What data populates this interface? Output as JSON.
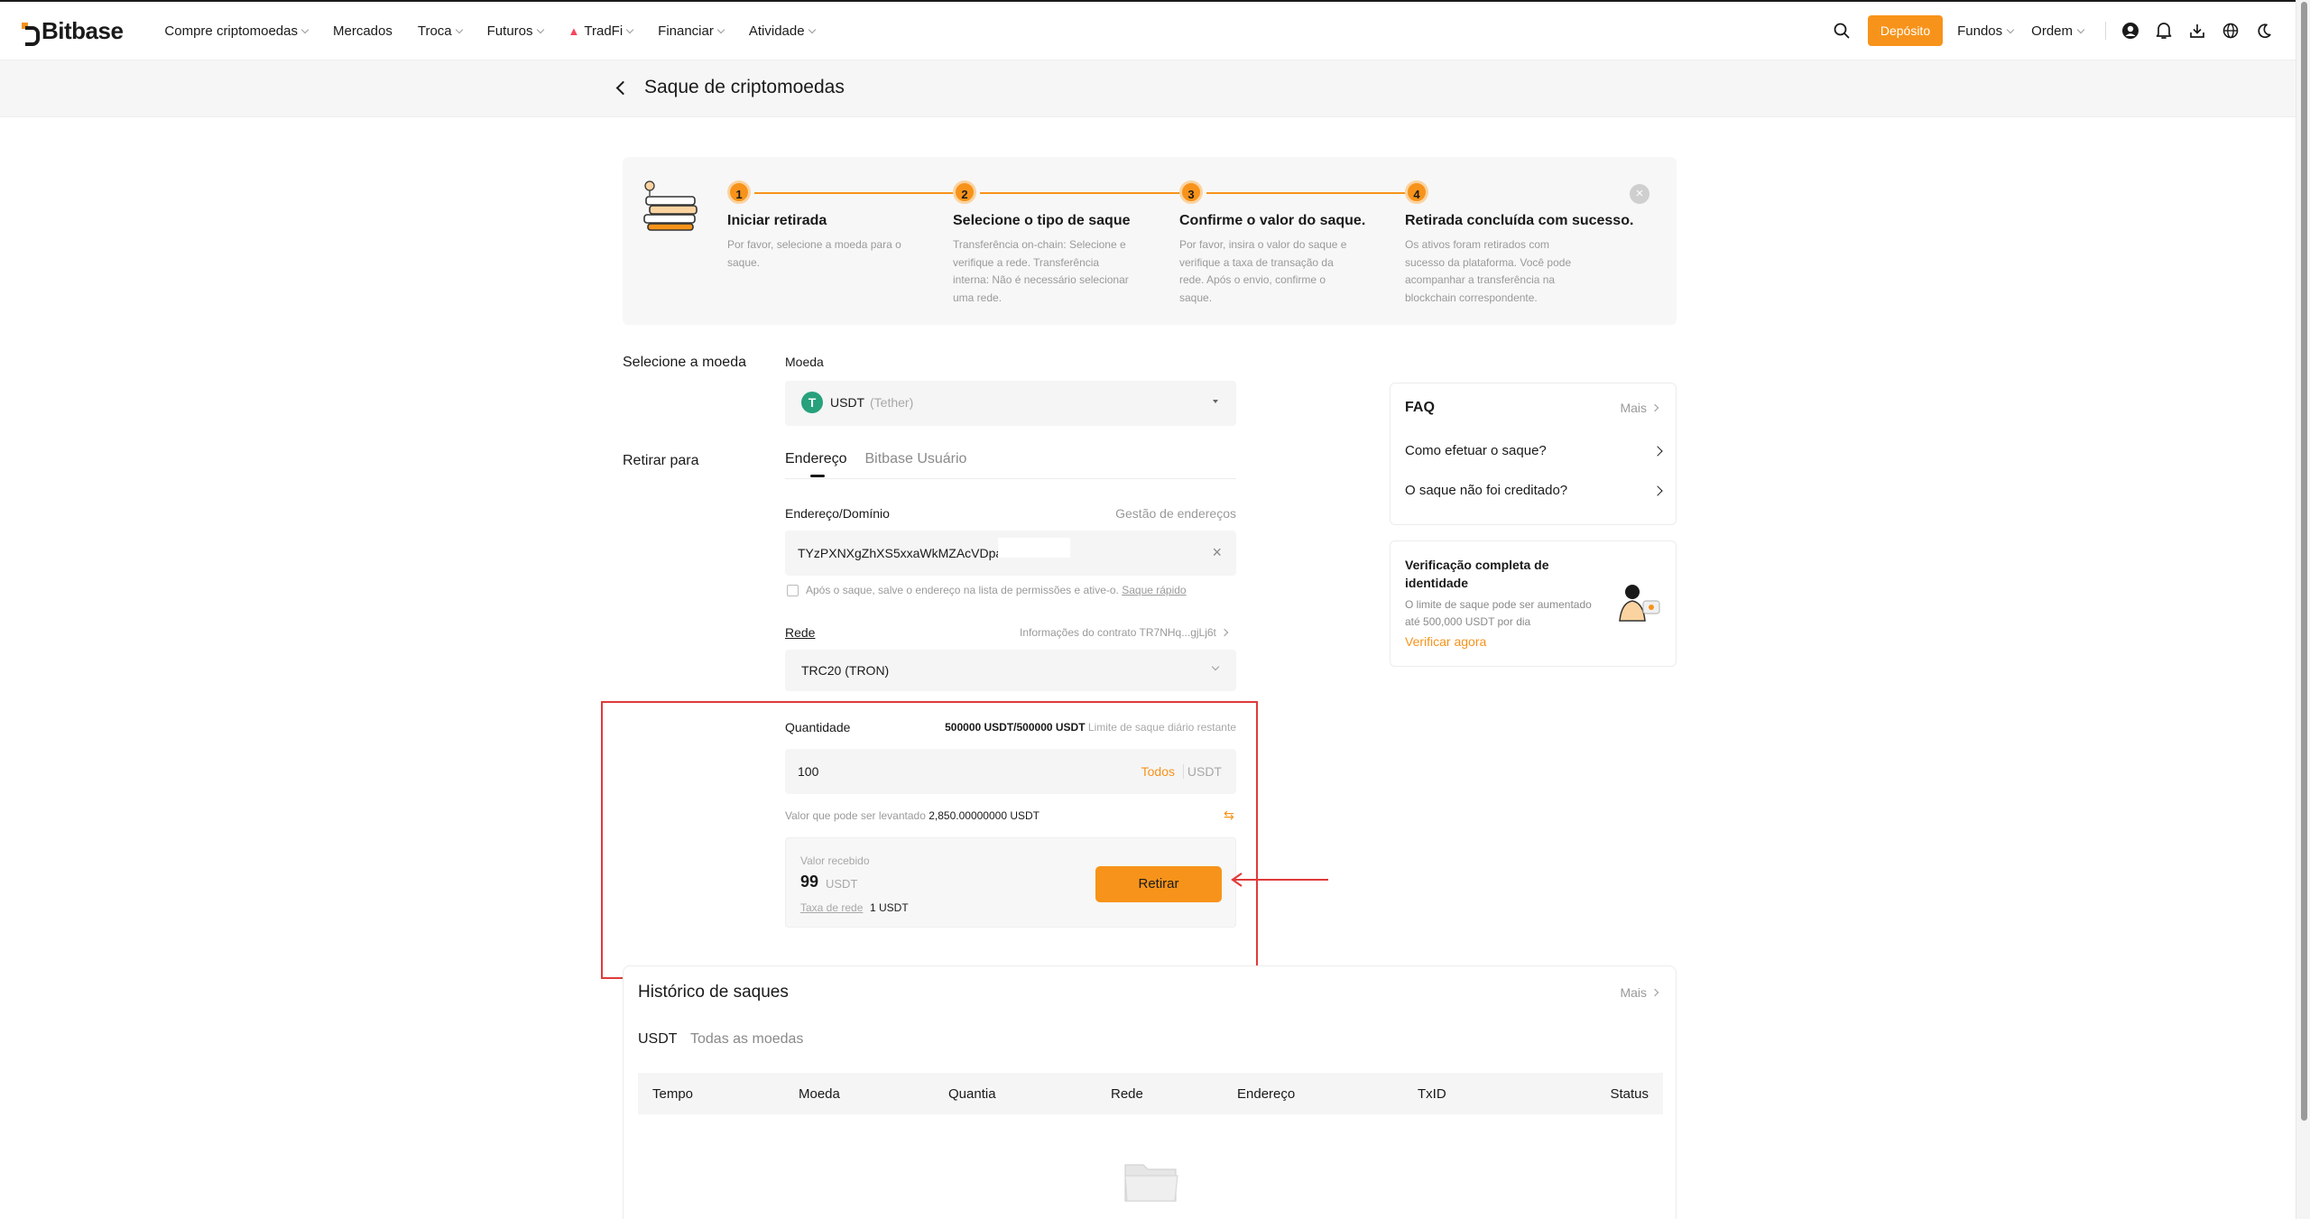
{
  "nav": {
    "logo": "Bitbase",
    "items": [
      "Compre criptomoedas",
      "Mercados",
      "Troca",
      "Futuros",
      "TradFi",
      "Financiar",
      "Atividade"
    ],
    "deposit": "Depósito",
    "funds": "Fundos",
    "order": "Ordem"
  },
  "page": {
    "title": "Saque de criptomoedas"
  },
  "steps": [
    {
      "num": "1",
      "title": "Iniciar retirada",
      "desc": "Por favor, selecione a moeda para o saque."
    },
    {
      "num": "2",
      "title": "Selecione o tipo de saque",
      "desc": "Transferência on-chain: Selecione e verifique a rede. Transferência interna: Não é necessário selecionar uma rede."
    },
    {
      "num": "3",
      "title": "Confirme o valor do saque.",
      "desc": "Por favor, insira o valor do saque e verifique a taxa de transação da rede. Após o envio, confirme o saque."
    },
    {
      "num": "4",
      "title": "Retirada concluída com sucesso.",
      "desc": "Os ativos foram retirados com sucesso da plataforma. Você pode acompanhar a transferência na blockchain correspondente."
    }
  ],
  "form": {
    "select_coin_label": "Selecione a moeda",
    "coin_label": "Moeda",
    "coin_symbol": "USDT",
    "coin_name": "(Tether)",
    "withdraw_to_label": "Retirar para",
    "tab_address": "Endereço",
    "tab_user": "Bitbase Usuário",
    "address_label": "Endereço/Domínio",
    "address_mgmt": "Gestão de endereços",
    "address_value": "TYzPXNXgZhXS5xxaWkMZAcVDpa",
    "save_text": "Após o saque, salve o endereço na lista de permissões e ative-o.",
    "quick_withdraw": "Saque rápido",
    "network_label": "Rede",
    "contract_info": "Informações do contrato TR7NHq...gjLj6t",
    "network_value": "TRC20 (TRON)",
    "quantity_label": "Quantidade",
    "limit_value": "500000 USDT/500000 USDT",
    "limit_text": "Limite de saque diário restante",
    "amount_value": "100",
    "all_btn": "Todos",
    "unit": "USDT",
    "available_label": "Valor que pode ser levantado",
    "available_value": "2,850.00000000 USDT",
    "received_label": "Valor recebido",
    "received_value": "99",
    "received_unit": "USDT",
    "fee_label": "Taxa de rede",
    "fee_value": "1 USDT",
    "submit": "Retirar"
  },
  "faq": {
    "title": "FAQ",
    "more": "Mais",
    "items": [
      "Como efetuar o saque?",
      "O saque não foi creditado?"
    ]
  },
  "verify": {
    "title": "Verificação completa de identidade",
    "desc": "O limite de saque pode ser aumentado até 500,000 USDT por dia",
    "link": "Verificar agora"
  },
  "history": {
    "title": "Histórico de saques",
    "more": "Mais",
    "tab_usdt": "USDT",
    "tab_all": "Todas as moedas",
    "columns": [
      "Tempo",
      "Moeda",
      "Quantia",
      "Rede",
      "Endereço",
      "TxID",
      "Status"
    ]
  },
  "colors": {
    "accent": "#f7931a",
    "highlight": "#e03a3a",
    "tether": "#26a17b"
  }
}
